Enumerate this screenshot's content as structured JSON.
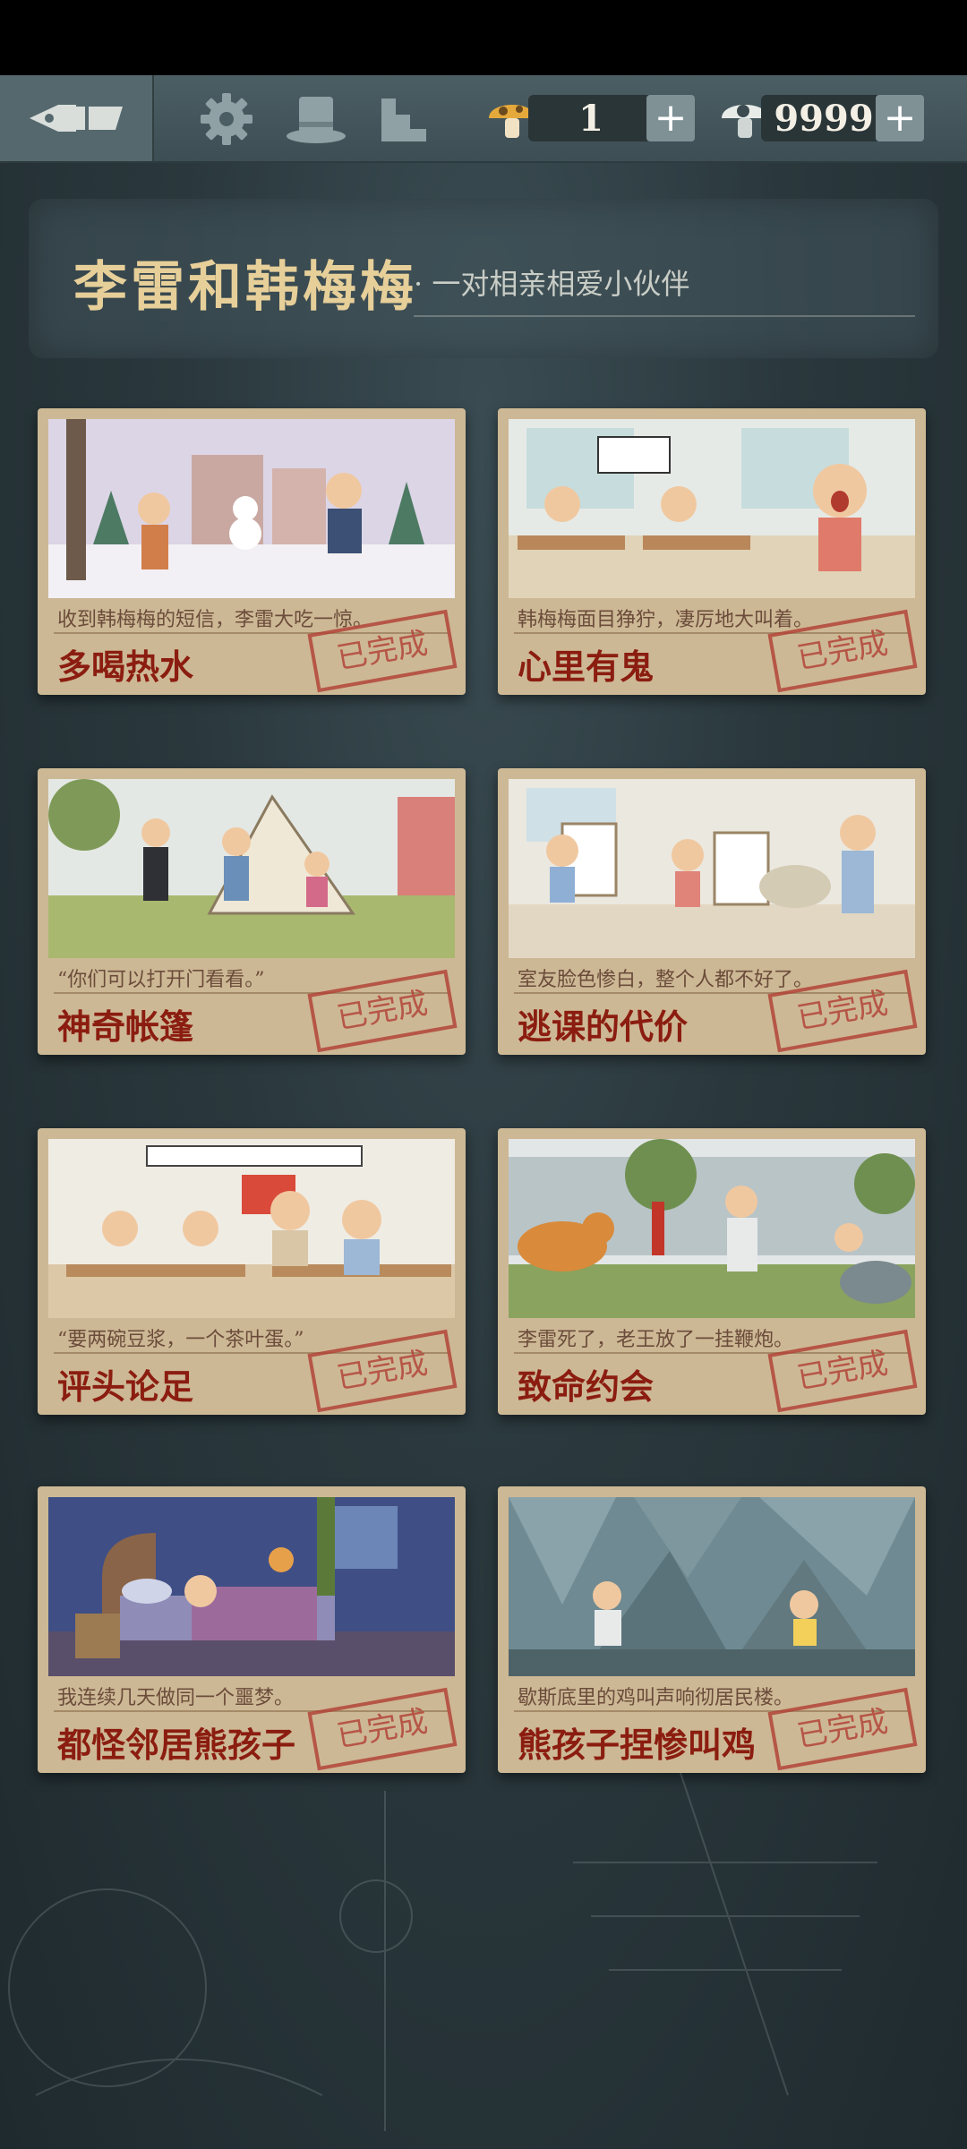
{
  "toolbar": {
    "back_icon": "fountain-pen-icon",
    "settings_icon": "gear-icon",
    "hat_icon": "top-hat-icon",
    "stairs_icon": "stairs-icon",
    "mushroom_count": "1",
    "coin_count": "9999",
    "plus": "+"
  },
  "banner": {
    "title": "李雷和韩梅梅",
    "subtitle": "· 一对相亲相爱小伙伴"
  },
  "cards": [
    {
      "caption": "收到韩梅梅的短信，李雷大吃一惊。",
      "title": "多喝热水",
      "status": "已完成"
    },
    {
      "caption": "韩梅梅面目狰狞，凄厉地大叫着。",
      "title": "心里有鬼",
      "status": "已完成"
    },
    {
      "caption": "“你们可以打开门看看。”",
      "title": "神奇帐篷",
      "status": "已完成"
    },
    {
      "caption": "室友脸色惨白，整个人都不好了。",
      "title": "逃课的代价",
      "status": "已完成"
    },
    {
      "caption": "“要两碗豆浆，一个茶叶蛋。”",
      "title": "评头论足",
      "status": "已完成"
    },
    {
      "caption": "李雷死了，老王放了一挂鞭炮。",
      "title": "致命约会",
      "status": "已完成"
    },
    {
      "caption": "我连续几天做同一个噩梦。",
      "title": "都怪邻居熊孩子",
      "status": "已完成"
    },
    {
      "caption": "歇斯底里的鸡叫声响彻居民楼。",
      "title": "熊孩子捏惨叫鸡",
      "status": "已完成"
    }
  ]
}
